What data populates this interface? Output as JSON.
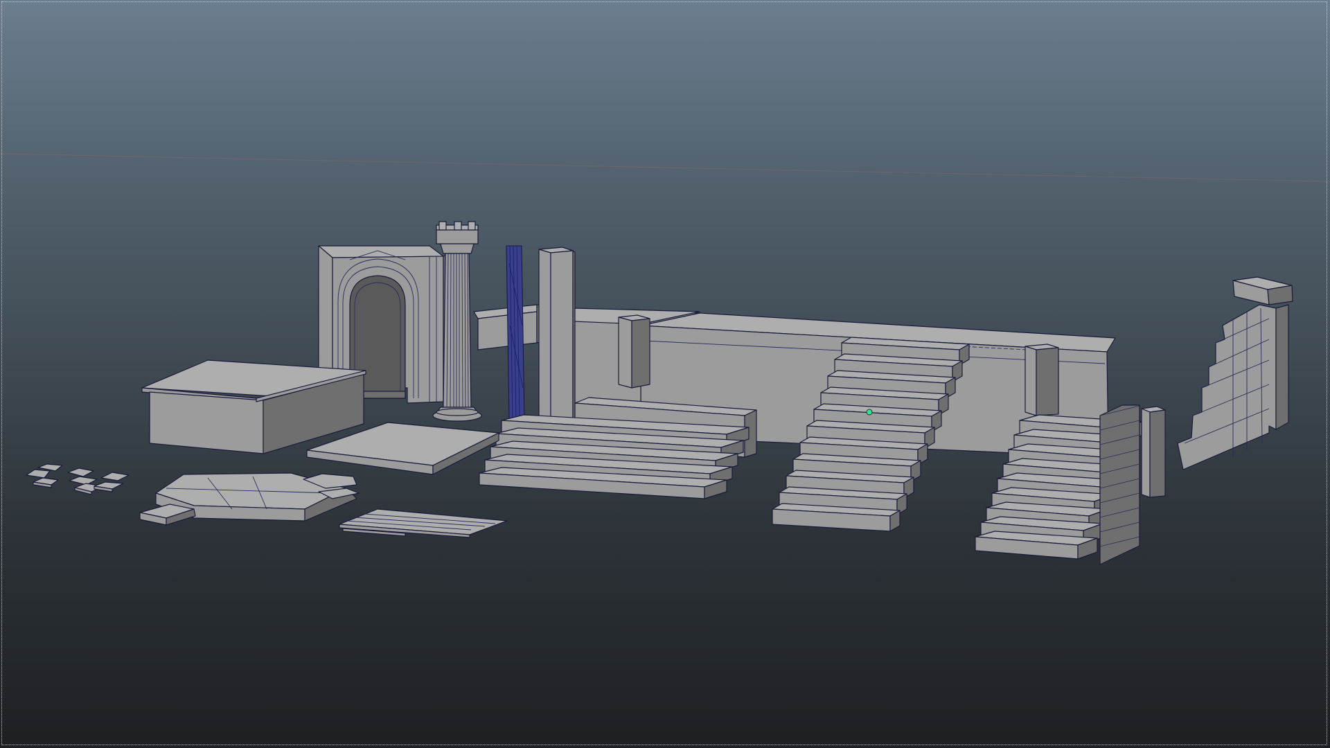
{
  "viewport": {
    "name": "perspective-viewport",
    "background_top": "#6b7e8f",
    "background_bottom": "#1d2023",
    "mesh_color": "#9c9c9c",
    "wireframe_color": "#1a1a3a",
    "selection_color": "#3a3f8c",
    "pivot_color": "#3ddc97"
  },
  "scene_objects": [
    {
      "name": "arch-doorway"
    },
    {
      "name": "tower-column"
    },
    {
      "name": "selected-thin-column"
    },
    {
      "name": "tall-pillar"
    },
    {
      "name": "raised-platform"
    },
    {
      "name": "center-staircase"
    },
    {
      "name": "wide-steps"
    },
    {
      "name": "right-staircase"
    },
    {
      "name": "ruined-wall"
    },
    {
      "name": "floor-slabs"
    },
    {
      "name": "rubble-pieces"
    }
  ]
}
